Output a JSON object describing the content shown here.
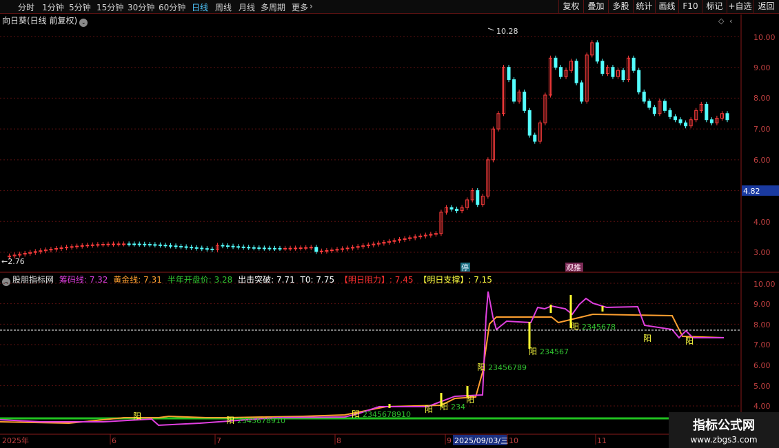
{
  "toolbar": {
    "periods": [
      "分时",
      "1分钟",
      "5分钟",
      "15分钟",
      "30分钟",
      "60分钟",
      "日线",
      "周线",
      "月线",
      "多周期",
      "更多"
    ],
    "active_period": "日线",
    "right_buttons": [
      "复权",
      "叠加",
      "多股",
      "统计",
      "画线",
      "F10",
      "标记",
      "+自选",
      "返回"
    ]
  },
  "main_chart": {
    "title": "向日葵(日线 前复权)",
    "chevron": "⌄",
    "y_ticks": [
      "10.00",
      "9.00",
      "8.00",
      "7.00",
      "6.00",
      "4.00",
      "3.00"
    ],
    "current_price": "4.82",
    "high_label": "10.28",
    "low_label": "2.76",
    "tag_stop": "停",
    "tag_pos": "观推"
  },
  "indicator": {
    "name": "股朋指标网",
    "fields": [
      {
        "label": "筹码线:",
        "value": "7.32",
        "color": "#e040e0"
      },
      {
        "label": "黄金线:",
        "value": "7.31",
        "color": "#ffa030"
      },
      {
        "label": "半年开盘价:",
        "value": "3.28",
        "color": "#30c030"
      },
      {
        "label": "出击突破:",
        "value": "7.71",
        "color": "#ffffff"
      },
      {
        "label": "T0:",
        "value": "7.75",
        "color": "#ffffff"
      },
      {
        "label": "【明日阻力】:",
        "value": "7.45",
        "color": "#ff3030"
      },
      {
        "label": "【明日支撑】:",
        "value": "7.15",
        "color": "#ffff40"
      }
    ],
    "y_ticks": [
      "10.00",
      "9.00",
      "8.00",
      "7.00",
      "6.00",
      "5.00",
      "4.00"
    ],
    "signals": [
      {
        "text": "阳",
        "sub": ""
      },
      {
        "text": "阳",
        "sub": "2345678910"
      },
      {
        "text": "阳",
        "sub": "2345678910"
      },
      {
        "text": "阳",
        "sub": "234"
      },
      {
        "text": "阳",
        "sub": ""
      },
      {
        "text": "阳",
        "sub": "23456789"
      },
      {
        "text": "阳",
        "sub": "234567"
      },
      {
        "text": "阳",
        "sub": "2345678"
      },
      {
        "text": "阳",
        "sub": ""
      },
      {
        "text": "阳",
        "sub": ""
      }
    ]
  },
  "x_axis": {
    "labels": [
      "2025年",
      "6",
      "7",
      "8",
      "9",
      "10",
      "11"
    ],
    "cursor_date": "2025/09/03/三"
  },
  "watermark": {
    "title": "指标公式网",
    "url": "www.zbgs3.com"
  }
}
